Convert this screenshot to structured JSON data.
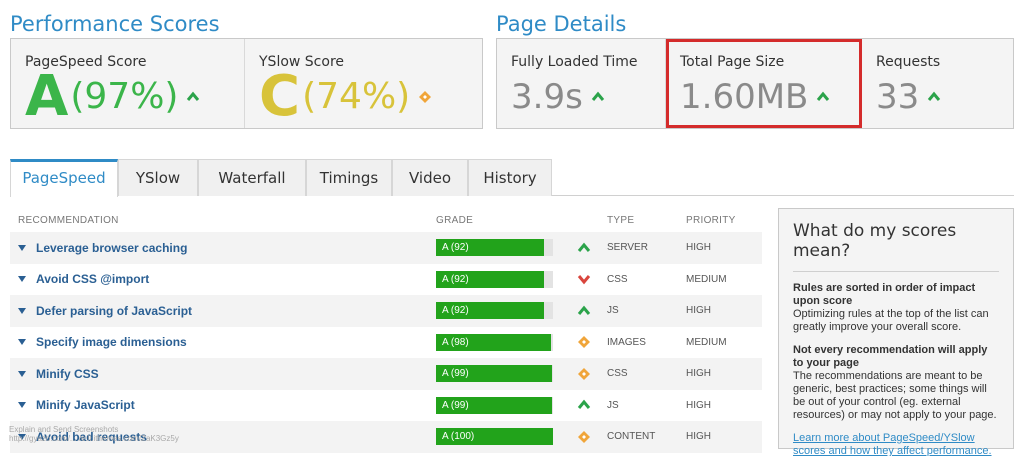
{
  "performance": {
    "title": "Performance Scores",
    "pagespeed": {
      "label": "PageSpeed Score",
      "grade": "A",
      "percent": "(97%)",
      "grade_color": "#3bb54a",
      "trend_icon": "up-arrow-icon"
    },
    "yslow": {
      "label": "YSlow Score",
      "grade": "C",
      "percent": "(74%)",
      "grade_color": "#d8c33a",
      "trend_icon": "diamond-icon"
    }
  },
  "page_details": {
    "title": "Page Details",
    "loaded": {
      "label": "Fully Loaded Time",
      "value": "3.9s"
    },
    "size": {
      "label": "Total Page Size",
      "value": "1.60MB"
    },
    "requests": {
      "label": "Requests",
      "value": "33"
    }
  },
  "tabs": [
    {
      "label": "PageSpeed",
      "active": true
    },
    {
      "label": "YSlow"
    },
    {
      "label": "Waterfall"
    },
    {
      "label": "Timings"
    },
    {
      "label": "Video"
    },
    {
      "label": "History"
    }
  ],
  "table": {
    "headers": {
      "recommendation": "RECOMMENDATION",
      "grade": "GRADE",
      "type": "TYPE",
      "priority": "PRIORITY"
    },
    "rows": [
      {
        "name": "Leverage browser caching",
        "grade": "A (92)",
        "score": 92,
        "indicator": "up",
        "type": "SERVER",
        "priority": "HIGH"
      },
      {
        "name": "Avoid CSS @import",
        "grade": "A (92)",
        "score": 92,
        "indicator": "down",
        "type": "CSS",
        "priority": "MEDIUM"
      },
      {
        "name": "Defer parsing of JavaScript",
        "grade": "A (92)",
        "score": 92,
        "indicator": "up",
        "type": "JS",
        "priority": "HIGH"
      },
      {
        "name": "Specify image dimensions",
        "grade": "A (98)",
        "score": 98,
        "indicator": "diamond",
        "type": "IMAGES",
        "priority": "MEDIUM"
      },
      {
        "name": "Minify CSS",
        "grade": "A (99)",
        "score": 99,
        "indicator": "diamond",
        "type": "CSS",
        "priority": "HIGH"
      },
      {
        "name": "Minify JavaScript",
        "grade": "A (99)",
        "score": 99,
        "indicator": "up",
        "type": "JS",
        "priority": "HIGH"
      },
      {
        "name": "Avoid bad requests",
        "grade": "A (100)",
        "score": 100,
        "indicator": "diamond",
        "type": "CONTENT",
        "priority": "HIGH"
      }
    ]
  },
  "scores_info": {
    "title": "What do my scores mean?",
    "p1_bold": "Rules are sorted in order of impact upon score",
    "p1_text": "Optimizing rules at the top of the list can greatly improve your overall score.",
    "p2_bold": "Not every recommendation will apply to your page",
    "p2_text": "The recommendations are meant to be generic, best practices; some things will be out of your control (eg. external resources) or may not apply to your page.",
    "link": "Learn more about PageSpeed/YSlow scores and how they affect performance."
  },
  "watermark": {
    "line1": "Explain and Send Screenshots",
    "line2": "http://gyazo.com/...   /e.ll.ithemes.com/ZaK3Gz5y"
  },
  "colors": {
    "accent": "#2f8bc6",
    "grade_green": "#22a31b",
    "up": "#2ba34a",
    "down": "#d9453d",
    "diamond": "#f0a53a",
    "highlight": "#d42b2b"
  }
}
